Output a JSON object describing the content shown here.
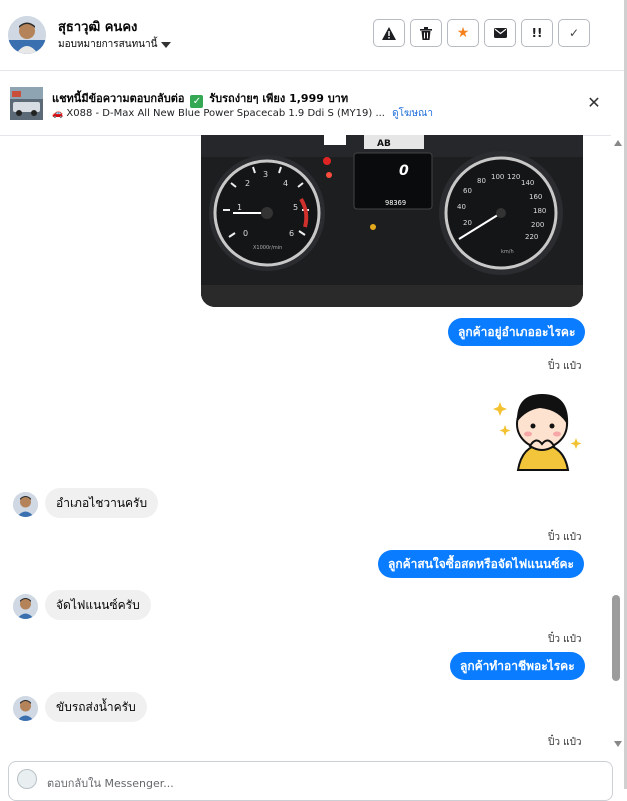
{
  "header": {
    "contact_name": "สุธาวุฒิ คนคง",
    "assign_label": "มอบหมายการสนทนานี้",
    "actions": [
      {
        "icon": "warning-icon",
        "glyph": "!"
      },
      {
        "icon": "trash-icon",
        "glyph": ""
      },
      {
        "icon": "star-icon",
        "glyph": "★"
      },
      {
        "icon": "mail-icon",
        "glyph": ""
      },
      {
        "icon": "double-exclamation-icon",
        "glyph": "!!"
      },
      {
        "icon": "check-icon",
        "glyph": "✓"
      }
    ],
    "star_color": "#f5821f"
  },
  "banner": {
    "title_before": "แชทนี้มีข้อความตอบกลับต่อ",
    "check_glyph": "✓",
    "title_after": "รับรถง่ายๆ เพียง 1,999 บาท",
    "subtitle_car": "🚗",
    "subtitle": "X088 - D-Max All New Blue Power Spacecab 1.9 Ddi S (MY19) ...",
    "link": "ดูโฆษณา",
    "close_glyph": "✕"
  },
  "chat": {
    "dashboard": {
      "plate_text": "AB",
      "speed_readout": "0",
      "odometer": "98369",
      "rpm_label": "X1000r/min",
      "kmh_label": "km/h"
    },
    "messages": [
      {
        "id": "m1",
        "text": "ลูกค้าอยู่อำเภออะไรคะ"
      },
      {
        "id": "m2",
        "text": "อำเภอไชวานครับ"
      },
      {
        "id": "m3",
        "text": "ลูกค้าสนใจซื้อสดหรือจัดไฟแนนซ์คะ"
      },
      {
        "id": "m4",
        "text": "จัดไฟแนนซ์ครับ"
      },
      {
        "id": "m5",
        "text": "ลูกค้าทำอาชีพอะไรคะ"
      },
      {
        "id": "m6",
        "text": "ขับรถส่งน้ำครับ"
      }
    ],
    "seen_label": "ปิ๋ว แป๋ว",
    "bubble_color": "#0a7cff"
  },
  "reply": {
    "placeholder": "ตอบกลับใน Messenger..."
  }
}
